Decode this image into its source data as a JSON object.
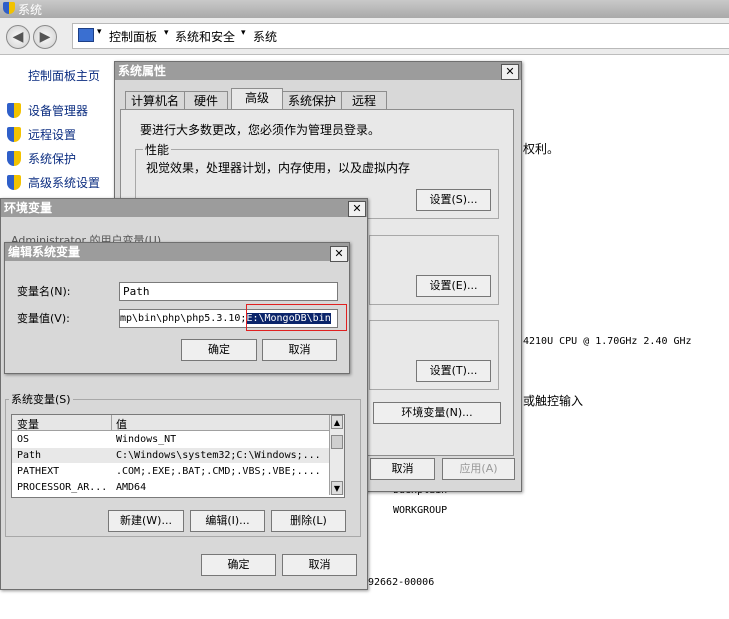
{
  "window": {
    "title": "系统"
  },
  "breadcrumb": {
    "items": [
      "控制面板",
      "系统和安全",
      "系统"
    ]
  },
  "sidebar": {
    "home_label": "控制面板主页",
    "items": [
      {
        "label": "设备管理器"
      },
      {
        "label": "远程设置"
      },
      {
        "label": "系统保护"
      },
      {
        "label": "高级系统设置"
      }
    ]
  },
  "background": {
    "rights_text": "权利。",
    "cpu_text": "4210U CPU @ 1.70GHz   2.40 GHz",
    "input_text": "或触控输入",
    "computer_name": "buexplain",
    "workgroup": "WORKGROUP",
    "product_id": "92662-00006"
  },
  "sysprops": {
    "title": "系统属性",
    "close": "✕",
    "tabs": [
      "计算机名",
      "硬件",
      "高级",
      "系统保护",
      "远程"
    ],
    "active_tab": "高级",
    "admin_note": "要进行大多数更改，您必须作为管理员登录。",
    "perf_title": "性能",
    "perf_desc": "视觉效果，处理器计划，内存使用，以及虚拟内存",
    "settings_s": "设置(S)...",
    "settings_e": "设置(E)...",
    "settings_t": "设置(T)...",
    "env_button": "环境变量(N)...",
    "cancel": "取消",
    "apply": "应用(A)"
  },
  "envvars": {
    "title": "环境变量",
    "close": "✕",
    "user_vars_partial": "Administrator 的用户变量(U)",
    "sys_vars_title": "系统变量(S)",
    "col_var": "变量",
    "col_val": "值",
    "rows": [
      {
        "name": "OS",
        "value": "Windows_NT"
      },
      {
        "name": "Path",
        "value": "C:\\Windows\\system32;C:\\Windows;..."
      },
      {
        "name": "PATHEXT",
        "value": ".COM;.EXE;.BAT;.CMD;.VBS;.VBE;...."
      },
      {
        "name": "PROCESSOR_AR...",
        "value": "AMD64"
      }
    ],
    "new": "新建(W)...",
    "edit": "编辑(I)...",
    "delete": "删除(L)",
    "ok": "确定",
    "cancel": "取消"
  },
  "editdlg": {
    "title": "编辑系统变量",
    "close": "✕",
    "name_label": "变量名(N):",
    "name_value": "Path",
    "value_label": "变量值(V):",
    "value_prefix": "mp\\bin\\php\\php5.3.10;",
    "value_selected": "E:\\MongoDB\\bin",
    "ok": "确定",
    "cancel": "取消"
  },
  "colors": {
    "highlight": "#0a246a",
    "annotation_box": "#e02020",
    "link": "#0b2d80"
  }
}
